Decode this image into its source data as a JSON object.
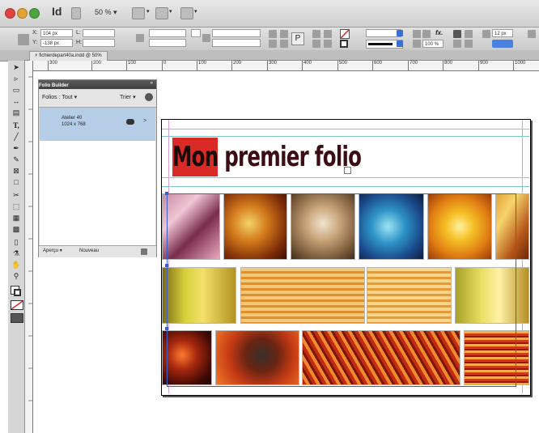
{
  "app": {
    "logo": "Id",
    "zoom": "50 %",
    "colors": {
      "accent": "#3a5fd1",
      "brand_red": "#d92a25",
      "title_dark": "#3c0d14"
    }
  },
  "control_panel": {
    "x_label": "X:",
    "x_value": "104 px",
    "y_label": "Y:",
    "y_value": "-138 px",
    "l_label": "L:",
    "h_label": "H:",
    "percent_value": "100 %",
    "pt_value": "12 px",
    "p_icon_glyph": "P",
    "fx_glyph": "fx."
  },
  "document": {
    "tab_title": "fichierdepart40a.indd @ 50%",
    "close_glyph": "×"
  },
  "ruler": {
    "ticks": [
      "300",
      "200",
      "100",
      "0",
      "100",
      "200",
      "300",
      "400",
      "500",
      "600",
      "700",
      "800",
      "900",
      "1000"
    ]
  },
  "tools": {
    "icons": [
      "selection-icon",
      "direct-selection-icon",
      "page-icon",
      "gap-icon",
      "content-collector-icon",
      "type-icon",
      "line-icon",
      "pen-icon",
      "pencil-icon",
      "rectangle-frame-icon",
      "rectangle-icon",
      "scissors-icon",
      "free-transform-icon",
      "gradient-icon",
      "gradient-feather-icon",
      "note-icon",
      "eyedropper-icon",
      "hand-icon",
      "zoom-icon",
      "fill-stroke-icon",
      "swap-icon",
      "apply-color-icon",
      "view-mode-icon"
    ],
    "type_glyph": "T,"
  },
  "folio_builder": {
    "title": "Folio Builder",
    "folios_label": "Folios : Tout",
    "sort_label": "Trier",
    "folio_name": "Atelier 40",
    "folio_size": "1024 x 768",
    "preview_button": "Aperçu",
    "new_button": "Nouveau",
    "chevron_glyph": ">",
    "dropdown_glyph": "▾"
  },
  "page": {
    "title_mon": "Mon",
    "title_rest": " premier folio"
  }
}
